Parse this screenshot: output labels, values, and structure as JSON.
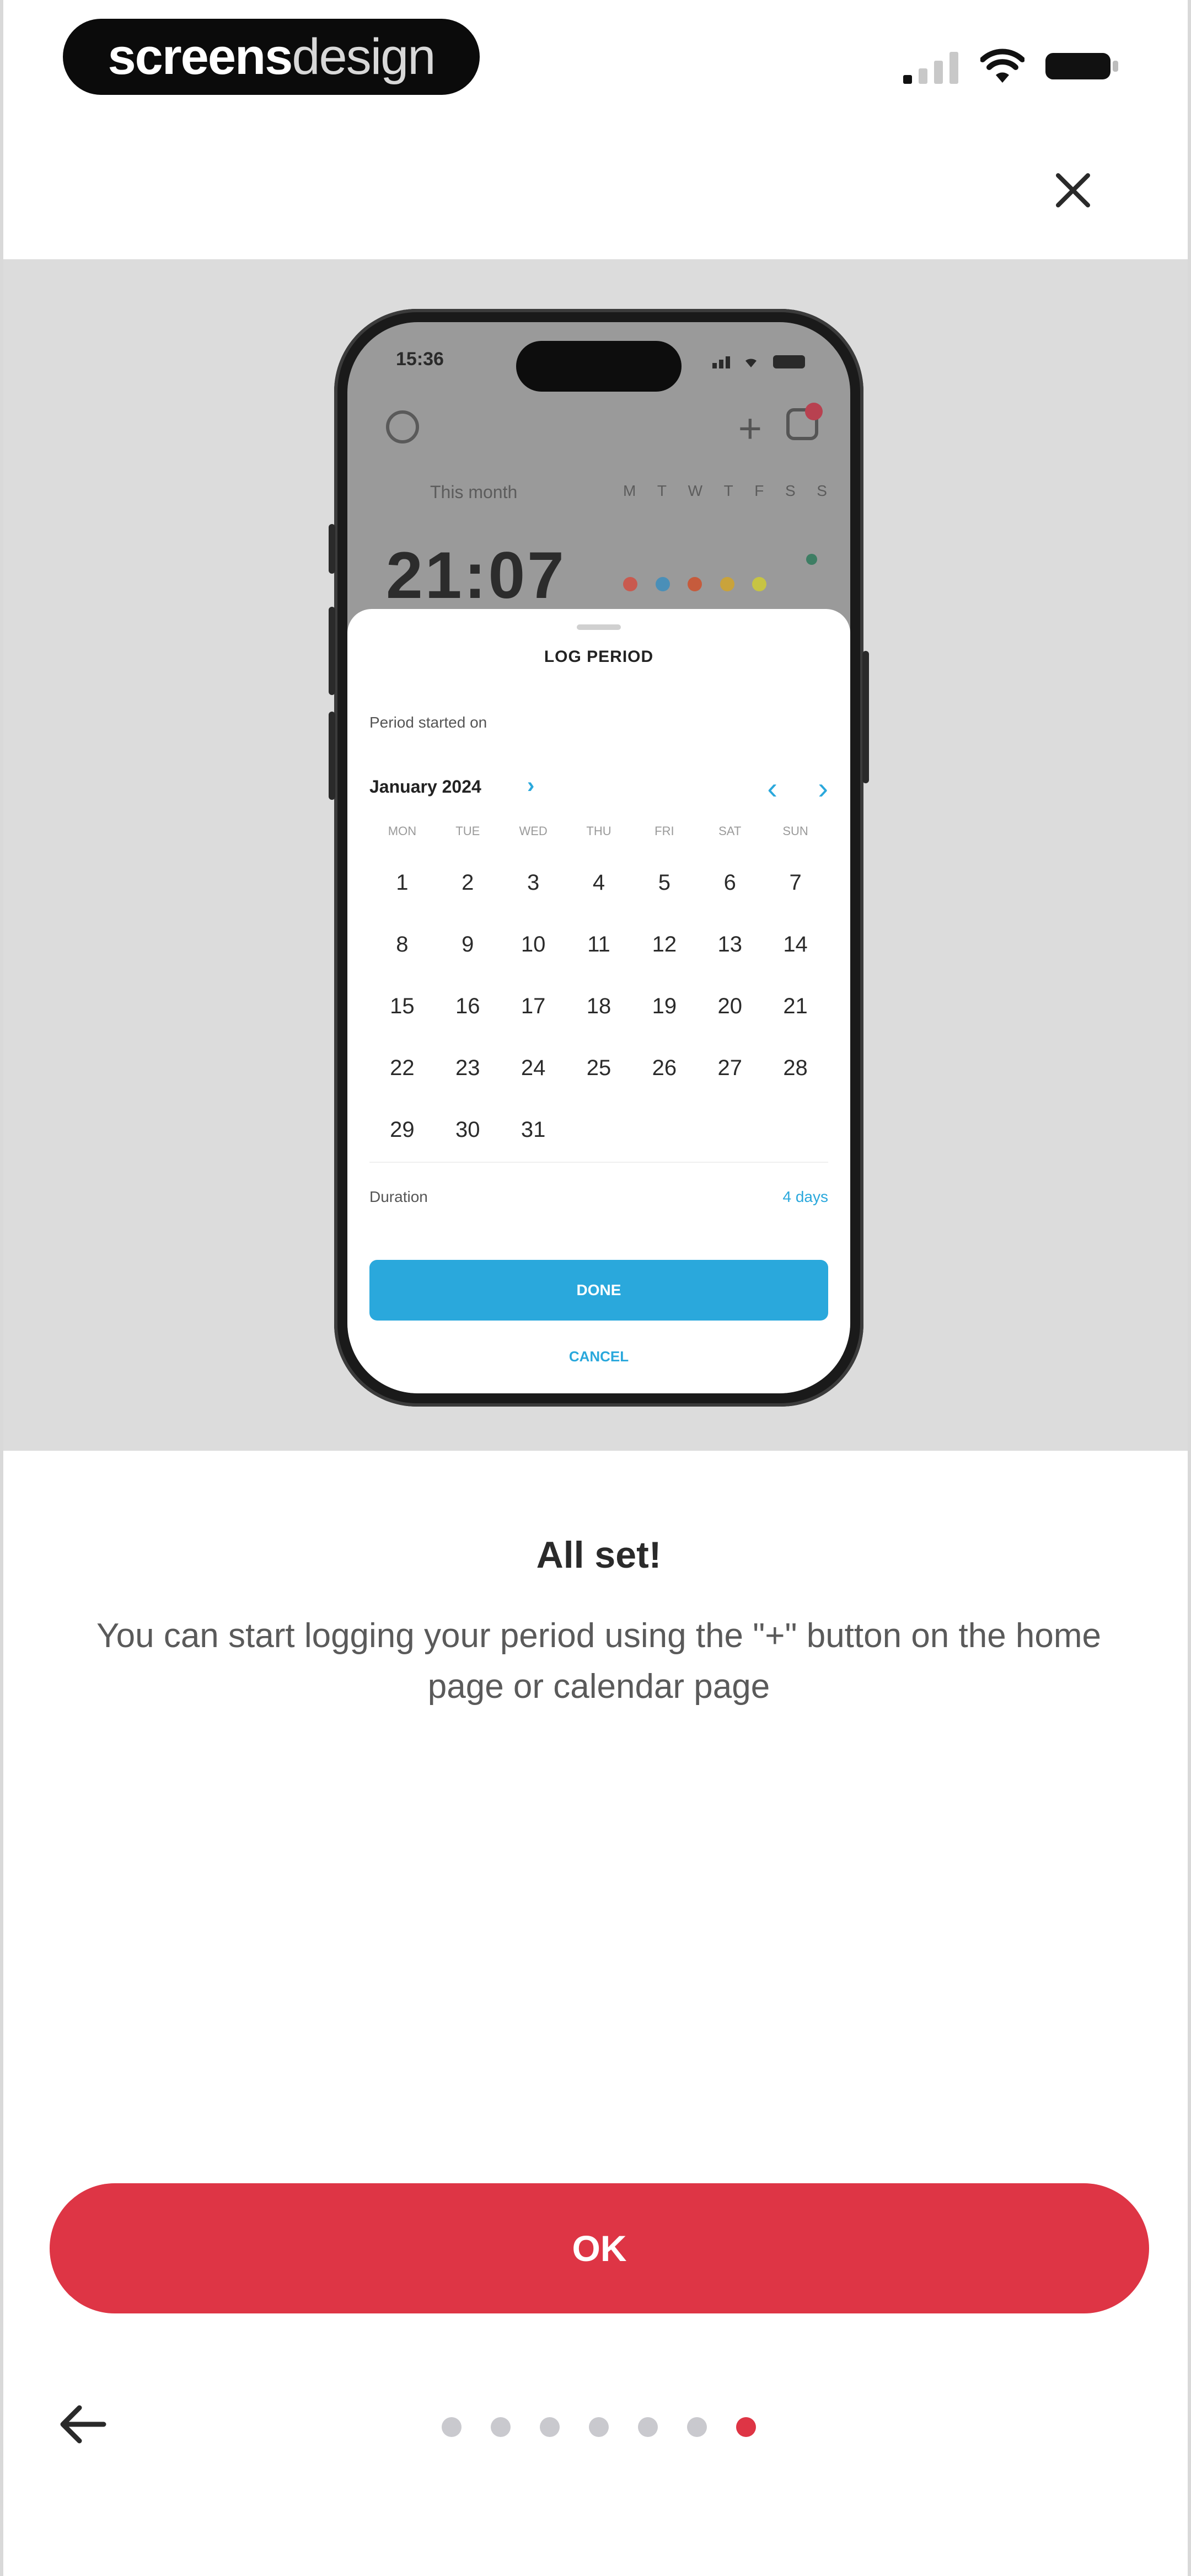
{
  "watermark": {
    "strong": "screens",
    "light": "design"
  },
  "icons": {
    "signal": "cellular-signal-icon",
    "wifi": "wifi-icon",
    "battery": "battery-icon",
    "close": "close-icon",
    "back": "arrow-left-icon"
  },
  "hero": {
    "phone": {
      "status_time": "15:36",
      "this_month_label": "This month",
      "week_letters": [
        "M",
        "T",
        "W",
        "T",
        "F",
        "S",
        "S"
      ],
      "big_number": "21:07",
      "dot_colors": [
        "#c95a4f",
        "#4a8fb8",
        "#c65b3c",
        "#c9a33b",
        "#c7c443"
      ],
      "sheet": {
        "title": "LOG PERIOD",
        "started_label": "Period started on",
        "month_label": "January 2024",
        "weekdays": [
          "MON",
          "TUE",
          "WED",
          "THU",
          "FRI",
          "SAT",
          "SUN"
        ],
        "days": [
          "1",
          "2",
          "3",
          "4",
          "5",
          "6",
          "7",
          "8",
          "9",
          "10",
          "11",
          "12",
          "13",
          "14",
          "15",
          "16",
          "17",
          "18",
          "19",
          "20",
          "21",
          "22",
          "23",
          "24",
          "25",
          "26",
          "27",
          "28",
          "29",
          "30",
          "31"
        ],
        "duration_label": "Duration",
        "duration_value": "4 days",
        "primary_label": "DONE",
        "cancel_label": "CANCEL"
      }
    }
  },
  "content": {
    "headline": "All set!",
    "body": "You can start logging your period using the \"+\" button on the home page or calendar page"
  },
  "actions": {
    "ok_label": "OK"
  },
  "pager": {
    "total": 7,
    "active_index": 6
  },
  "colors": {
    "accent": "#de3545",
    "sheet_accent": "#2aa8dc",
    "hero_background": "#dcdcdc"
  }
}
